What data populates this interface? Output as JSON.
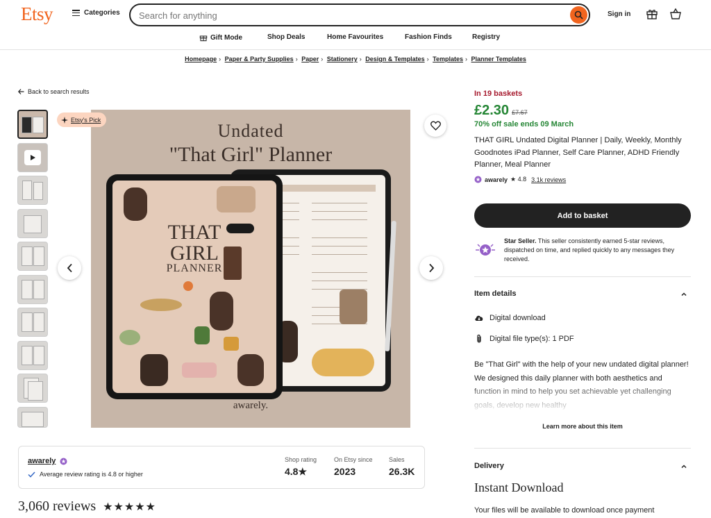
{
  "header": {
    "logo": "Etsy",
    "categories_label": "Categories",
    "search_placeholder": "Search for anything",
    "signin_label": "Sign in",
    "brand_color": "#f1641e"
  },
  "nav": {
    "items": [
      "Gift Mode",
      "Shop Deals",
      "Home Favourites",
      "Fashion Finds",
      "Registry"
    ]
  },
  "breadcrumb": [
    "Homepage",
    "Paper & Party Supplies",
    "Paper",
    "Stationery",
    "Design & Templates",
    "Templates",
    "Planner Templates"
  ],
  "back_label": "Back to search results",
  "gallery": {
    "badge": "Etsy's Pick",
    "image_text": {
      "title_line1": "Undated",
      "title_line2": "\"That Girl\" Planner",
      "cover_line1": "THAT",
      "cover_line2": "GIRL",
      "cover_line3": "PLANNER",
      "brand": "awarely."
    }
  },
  "shop_card": {
    "shop_name": "awarely",
    "avg_rating_text": "Average review rating is 4.8 or higher",
    "stats": [
      {
        "label": "Shop rating",
        "value": "4.8★"
      },
      {
        "label": "On Etsy since",
        "value": "2023"
      },
      {
        "label": "Sales",
        "value": "26.3K"
      }
    ]
  },
  "reviews": {
    "title": "3,060 reviews",
    "stars": "★★★★★"
  },
  "product": {
    "baskets": "In 19 baskets",
    "price": "£2.30",
    "old_price": "£7.67",
    "sale_text": "70% off sale ends 09 March",
    "title": "THAT GIRL Undated Digital Planner | Daily, Weekly, Monthly Goodnotes iPad Planner, Self Care Planner, ADHD Friendly Planner, Meal Planner",
    "shop": "awarely",
    "rating": "★ 4.8",
    "reviews_link": "3.1k reviews",
    "add_to_basket": "Add to basket",
    "star_seller_bold": "Star Seller.",
    "star_seller_text": " This seller consistently earned 5-star reviews, dispatched on time, and replied quickly to any messages they received."
  },
  "item_details": {
    "heading": "Item details",
    "rows": [
      "Digital download",
      "Digital file type(s): 1 PDF"
    ],
    "description": "Be \"That Girl\" with the help of your new undated digital planner! We designed this daily planner with both aesthetics and function in mind to help you set achievable yet challenging goals, develop new healthy",
    "learn_more": "Learn more about this item"
  },
  "delivery": {
    "heading": "Delivery",
    "title": "Instant Download",
    "text": "Your files will be available to download once payment"
  },
  "colors": {
    "price_green": "#258635",
    "basket_red": "#a61a2e",
    "badge_bg": "#fcd5c0"
  }
}
